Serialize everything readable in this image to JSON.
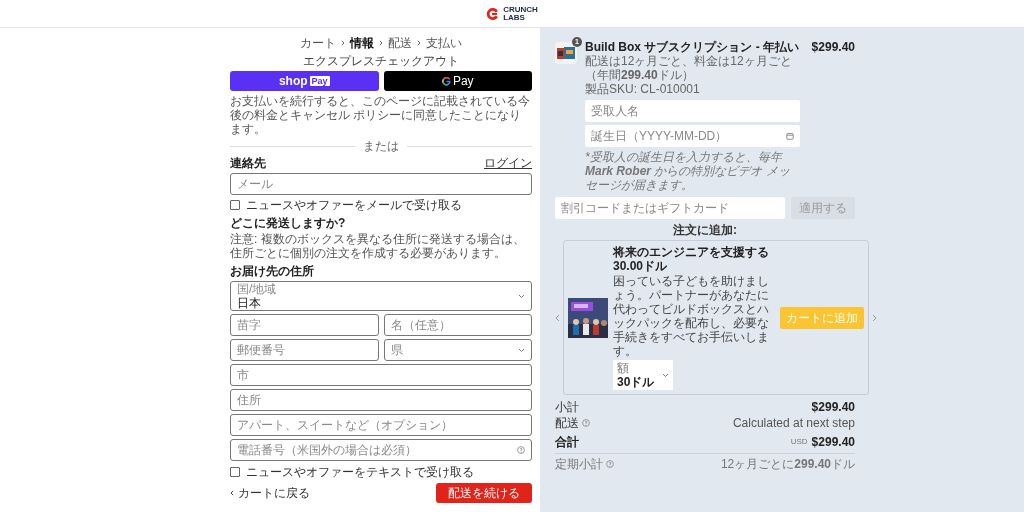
{
  "header": {
    "logo_line1": "CRUNCH",
    "logo_line2": "LABS"
  },
  "breadcrumb": [
    {
      "label": "カート",
      "selected": false
    },
    {
      "label": "情報",
      "selected": true
    },
    {
      "label": "配送",
      "selected": false
    },
    {
      "label": "支払い",
      "selected": false
    }
  ],
  "express": {
    "title": "エクスプレスチェックアウト",
    "buttons": [
      {
        "kind": "shop",
        "label": "shop",
        "badge": "Pay"
      },
      {
        "kind": "gpay",
        "label": "Pay"
      }
    ],
    "note": "お支払いを続行すると、このページに記載されている今後の料金とキャンセル ポリシーに同意したことになります。"
  },
  "divider_label": "または",
  "contact": {
    "heading": "連絡先",
    "login_link": "ログイン",
    "email_placeholder": "メール",
    "newsletter": {
      "label": "ニュースやオファーをメールで受け取る",
      "checked": false
    }
  },
  "shipping_question": {
    "heading": "どこに発送しますか?",
    "text": "注意: 複数のボックスを異なる住所に発送する場合は、住所ごとに個別の注文を作成する必要があります。"
  },
  "address": {
    "heading": "お届け先の住所",
    "rows": [
      [
        {
          "kind": "select",
          "label": "国/地域",
          "value": "日本"
        }
      ],
      [
        {
          "kind": "text",
          "placeholder": "苗字"
        },
        {
          "kind": "text",
          "placeholder": "名（任意）"
        }
      ],
      [
        {
          "kind": "text",
          "placeholder": "郵便番号"
        },
        {
          "kind": "select",
          "placeholder": "県"
        }
      ],
      [
        {
          "kind": "text",
          "placeholder": "市"
        }
      ],
      [
        {
          "kind": "text",
          "placeholder": "住所"
        }
      ],
      [
        {
          "kind": "text",
          "placeholder": "アパート、スイートなど（オプション）"
        }
      ],
      [
        {
          "kind": "phone",
          "placeholder": "電話番号（米国外の場合は必須）"
        }
      ]
    ]
  },
  "sms_opt_in": {
    "label": "ニュースやオファーをテキストで受け取る",
    "checked": false
  },
  "footer": {
    "back_link": "カートに戻る",
    "continue_button": "配送を続ける"
  },
  "line_item": {
    "quantity": "1",
    "title": "Build Box サブスクリプション - 年払い",
    "price": "$299.40",
    "description": "配送は12ヶ月ごと、料金は12ヶ月ごと（年間**299.40**ドル）",
    "sku": "製品SKU: CL-010001"
  },
  "recipient_fields": [
    {
      "kind": "text",
      "placeholder": "受取人名"
    },
    {
      "kind": "date",
      "placeholder": "誕生日（YYYY-MM-DD）"
    }
  ],
  "recipient_note": "*受取人の誕生日を入力すると、毎年 **Mark Rober** からの特別なビデオ メッセージが届きます。",
  "discount": {
    "placeholder": "割引コードまたはギフトカード",
    "button": "適用する",
    "disabled": true
  },
  "upsell": {
    "heading": "注文に追加:",
    "title": "将来のエンジニアを支援する",
    "price": "30.00ドル",
    "description": "困っている子どもを助けましょう。パートナーがあなたに代わってビルドボックスとハックパックを配布し、必要な手続きをすべてお手伝いします。",
    "option_label": "額",
    "option_value": "30ドル",
    "button": "カートに追加"
  },
  "summary": [
    {
      "kind": "line",
      "label": "小計",
      "value": "$299.40",
      "info": false
    },
    {
      "kind": "line",
      "label": "配送",
      "value": "Calculated at next step",
      "info": true
    },
    {
      "kind": "total",
      "label": "合計",
      "currency": "USD",
      "value": "$299.40",
      "info": false
    },
    {
      "kind": "recurring",
      "label": "定期小計",
      "value": "12ヶ月ごとに**299.40**ドル",
      "info": true
    }
  ]
}
